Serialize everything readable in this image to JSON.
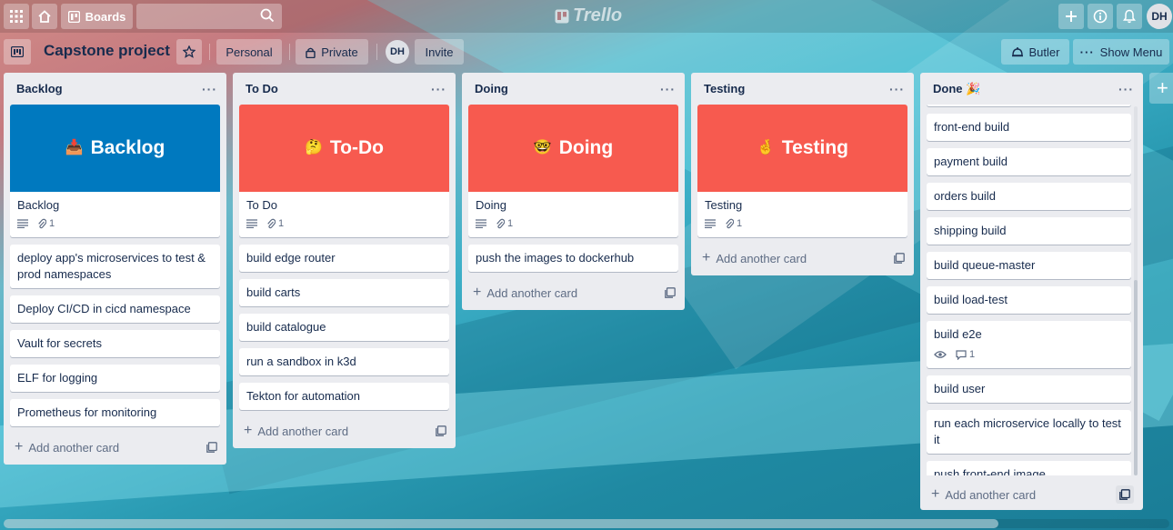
{
  "topbar": {
    "boards_label": "Boards",
    "logo_text": "Trello",
    "avatar_initials": "DH"
  },
  "board": {
    "title": "Capstone project",
    "visibility_team": "Personal",
    "visibility_private": "Private",
    "member_initials": "DH",
    "invite_label": "Invite",
    "butler_label": "Butler",
    "show_menu_label": "Show Menu"
  },
  "colors": {
    "cover_blue": "#0079bf",
    "cover_red": "#f75a4f"
  },
  "lists": [
    {
      "title": "Backlog",
      "cover": {
        "emoji": "📥",
        "text": "Backlog",
        "color": "#0079bf",
        "title": "Backlog",
        "attachments": "1"
      },
      "cards": [
        "deploy app's microservices to test & prod namespaces",
        "Deploy CI/CD in cicd namespace",
        "Vault for secrets",
        "ELF for logging",
        "Prometheus for monitoring"
      ],
      "add_label": "Add another card"
    },
    {
      "title": "To Do",
      "cover": {
        "emoji": "🤔",
        "text": "To-Do",
        "color": "#f75a4f",
        "title": "To Do",
        "attachments": "1"
      },
      "cards": [
        "build edge router",
        "build carts",
        "build catalogue",
        "run a sandbox in k3d",
        "Tekton for automation"
      ],
      "add_label": "Add another card"
    },
    {
      "title": "Doing",
      "cover": {
        "emoji": "🤓",
        "text": "Doing",
        "color": "#f75a4f",
        "title": "Doing",
        "attachments": "1"
      },
      "cards": [
        "push the images to dockerhub"
      ],
      "add_label": "Add another card"
    },
    {
      "title": "Testing",
      "cover": {
        "emoji": "🤞",
        "text": "Testing",
        "color": "#f75a4f",
        "title": "Testing",
        "attachments": "1"
      },
      "cards": [],
      "add_label": "Add another card"
    },
    {
      "title": "Done 🎉",
      "cards": [
        "front-end build",
        "payment build",
        "orders build",
        "shipping build",
        "build queue-master",
        "build load-test"
      ],
      "watched_card": {
        "title": "build e2e",
        "comments": "1"
      },
      "cards_after": [
        "build user",
        "run each microservice locally to test it",
        "push front-end image"
      ],
      "add_label": "Add another card"
    }
  ]
}
